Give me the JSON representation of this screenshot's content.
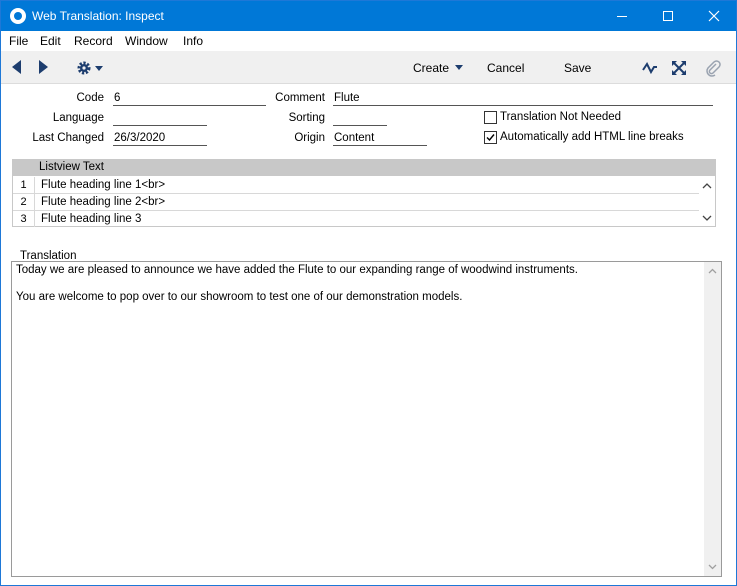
{
  "window": {
    "title": "Web Translation: Inspect",
    "accent_color": "#0078d7"
  },
  "menu": [
    "File",
    "Edit",
    "Record",
    "Window",
    "Info"
  ],
  "toolbar": {
    "create_label": "Create",
    "cancel_label": "Cancel",
    "save_label": "Save"
  },
  "form": {
    "code_label": "Code",
    "code_value": "6",
    "comment_label": "Comment",
    "comment_value": "Flute",
    "language_label": "Language",
    "language_value": "",
    "sorting_label": "Sorting",
    "sorting_value": "",
    "translation_not_needed_label": "Translation Not Needed",
    "translation_not_needed_checked": false,
    "last_changed_label": "Last Changed",
    "last_changed_value": "26/3/2020",
    "origin_label": "Origin",
    "origin_value": "Content",
    "auto_html_label": "Automatically add HTML line breaks",
    "auto_html_checked": true
  },
  "listview": {
    "header": "Listview Text",
    "rows": [
      {
        "num": "1",
        "text": "Flute heading line 1<br>"
      },
      {
        "num": "2",
        "text": "Flute heading line 2<br>"
      },
      {
        "num": "3",
        "text": "Flute heading line 3"
      }
    ]
  },
  "translation": {
    "label": "Translation",
    "lines": [
      "Today we are pleased to announce we have added the Flute to our expanding range of woodwind instruments.",
      "You are welcome to pop over to our showroom to test one of our demonstration models."
    ]
  }
}
